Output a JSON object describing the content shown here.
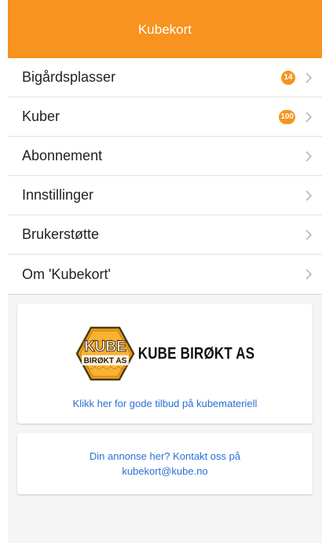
{
  "header": {
    "title": "Kubekort"
  },
  "menu": [
    {
      "label": "Bigårdsplasser",
      "badge": "14"
    },
    {
      "label": "Kuber",
      "badge": "100"
    },
    {
      "label": "Abonnement"
    },
    {
      "label": "Innstillinger"
    },
    {
      "label": "Brukerstøtte"
    },
    {
      "label": "Om 'Kubekort'"
    }
  ],
  "ad": {
    "logo_hex_top": "KUBE",
    "logo_hex_bottom": "BIRØKT AS",
    "logo_text": "KUBE BIRØKT AS",
    "link": "Klikk her for gode tilbud på kubemateriell"
  },
  "contact": {
    "line1": "Din annonse her? Kontakt oss på",
    "line2": "kubekort@kube.no"
  },
  "colors": {
    "accent": "#f7931e",
    "link": "#2a6fd6"
  },
  "icons": {
    "chevron": "chevron-right-icon"
  }
}
